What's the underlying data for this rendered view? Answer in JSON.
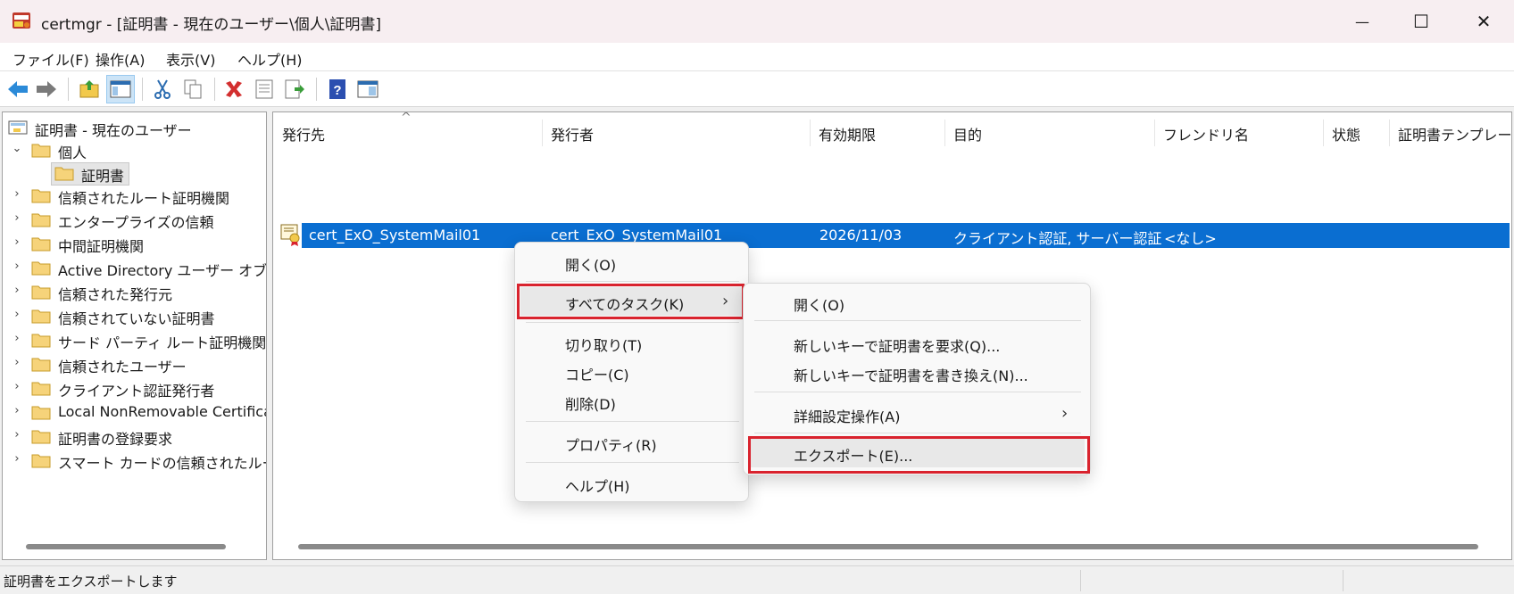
{
  "window": {
    "title": "certmgr - [証明書 - 現在のユーザー\\個人\\証明書]",
    "minimize_glyph": "—",
    "maximize_glyph": "☐",
    "close_glyph": "✕"
  },
  "menubar": {
    "items": [
      "ファイル(F)",
      "操作(A)",
      "表示(V)",
      "ヘルプ(H)"
    ]
  },
  "toolbar": {
    "buttons": [
      "back-arrow-icon",
      "forward-arrow-icon",
      "up-folder-icon",
      "show-hide-tree-icon",
      "cut-icon",
      "copy-icon",
      "delete-icon",
      "properties-icon",
      "export-list-icon",
      "help-icon",
      "console-view-icon"
    ]
  },
  "tree": {
    "root": "証明書 - 現在のユーザー",
    "personal": "個人",
    "personal_child": "証明書",
    "items": [
      "信頼されたルート証明機関",
      "エンタープライズの信頼",
      "中間証明機関",
      "Active Directory ユーザー オブジェ",
      "信頼された発行元",
      "信頼されていない証明書",
      "サード パーティ ルート証明機関",
      "信頼されたユーザー",
      "クライアント認証発行者",
      "Local NonRemovable Certifica",
      "証明書の登録要求",
      "スマート カードの信頼されたルート"
    ]
  },
  "list": {
    "sort_glyph": "^",
    "columns": [
      "発行先",
      "発行者",
      "有効期限",
      "目的",
      "フレンドリ名",
      "状態",
      "証明書テンプレート"
    ],
    "rows": [
      {
        "issued_to": "cert_ExO_SystemMail01",
        "issued_by": "cert_ExO_SystemMail01",
        "expiration": "2026/11/03",
        "purpose": "クライアント認証, サーバー認証",
        "friendly_name": "<なし>"
      }
    ]
  },
  "context_menu": {
    "open": "開く(O)",
    "all_tasks": "すべてのタスク(K)",
    "cut": "切り取り(T)",
    "copy": "コピー(C)",
    "delete": "削除(D)",
    "properties": "プロパティ(R)",
    "help": "ヘルプ(H)",
    "submenu_glyph": "›"
  },
  "submenu": {
    "open": "開く(O)",
    "request_new_key": "新しいキーで証明書を要求(Q)...",
    "renew_new_key": "新しいキーで証明書を書き換え(N)...",
    "advanced": "詳細設定操作(A)",
    "export": "エクスポート(E)...",
    "submenu_glyph": "›"
  },
  "statusbar": {
    "text": "証明書をエクスポートします"
  },
  "colors": {
    "selection": "#0a6ed1",
    "highlight_border": "#d9232e",
    "title_bg": "#f7eef1"
  }
}
